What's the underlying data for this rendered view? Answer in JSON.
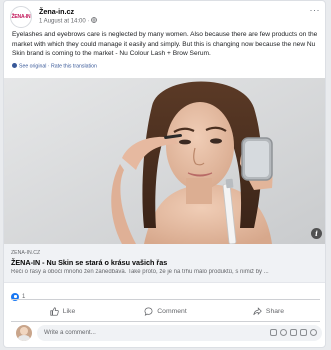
{
  "post": {
    "author": "Žena-in.cz",
    "avatar_text": "ŽENA-IN",
    "meta": "1 August at 14:00 · ",
    "more": "···",
    "text": "Eyelashes and eyebrows care is neglected by many women. Also because there are few products on the market with which they could manage it easily and simply. But this is changing now because the new Nu Skin brand is coming to the market - Nu Colour Lash + Brow Serum.",
    "see_original": "See original · Rate this translation"
  },
  "link": {
    "domain": "ZENA-IN.CZ",
    "title": "ŽENA-IN - Nu Skin se stará o krásu vašich řas",
    "description": "Řeči o řasy a obočí mnoho žen zanedbává. Také proto, že je na trhu málo produktů, s nimiž by ...",
    "info": "i"
  },
  "reactions": {
    "count": "1",
    "color": "#1877f2"
  },
  "actions": {
    "like": "Like",
    "comment": "Comment",
    "share": "Share"
  },
  "comment_box": {
    "placeholder": "Write a comment..."
  },
  "icons": [
    "globe-icon",
    "more-options-icon",
    "info-icon",
    "like-icon",
    "comment-icon",
    "share-icon",
    "emoji-icon",
    "camera-icon",
    "gif-icon",
    "sticker-icon"
  ]
}
